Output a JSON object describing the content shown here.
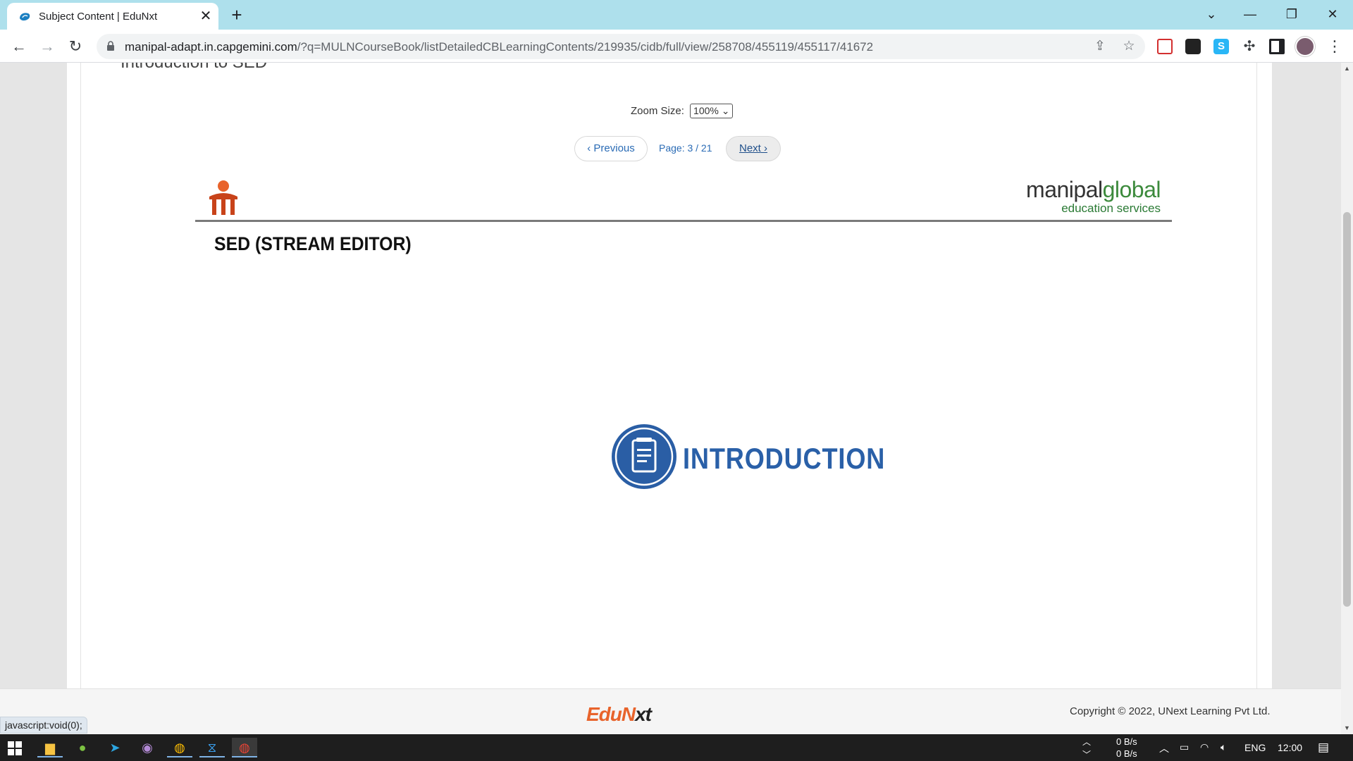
{
  "browser": {
    "tab_title": "Subject Content | EduNxt",
    "url_host": "manipal-adapt.in.capgemini.com",
    "url_path": "/?q=MULNCourseBook/listDetailedCBLearningContents/219935/cidb/full/view/258708/455119/455117/41672",
    "icons": [
      "edunxt-favicon",
      "back-arrow",
      "forward-arrow",
      "reload",
      "lock",
      "share",
      "bookmark-star",
      "extension-puzzle",
      "side-panel",
      "profile-avatar",
      "menu-kebab"
    ]
  },
  "page": {
    "clipped_heading": "Introduction to SED",
    "zoom_label": "Zoom Size:",
    "zoom_value": "100%",
    "pager": {
      "previous": "Previous",
      "page_label": "Page: 3 / 21",
      "next": "Next"
    },
    "slide": {
      "brand_main_a": "manipal",
      "brand_main_b": "global",
      "brand_sub": "education services",
      "title": "SED (STREAM EDITOR)",
      "section_label": "INTRODUCTION"
    },
    "footer": {
      "logo_a": "EduN",
      "logo_b": "xt",
      "copyright": "Copyright © 2022, UNext Learning Pvt Ltd."
    },
    "status_text": "javascript:void(0);"
  },
  "taskbar": {
    "net_up": "0 B/s",
    "net_down": "0 B/s",
    "language": "ENG",
    "time": "12:00"
  },
  "colors": {
    "tab_strip": "#aee0ec",
    "brand_blue": "#2a60a8",
    "brand_green": "#3c8a3c",
    "edunxt_orange": "#e8632b"
  }
}
